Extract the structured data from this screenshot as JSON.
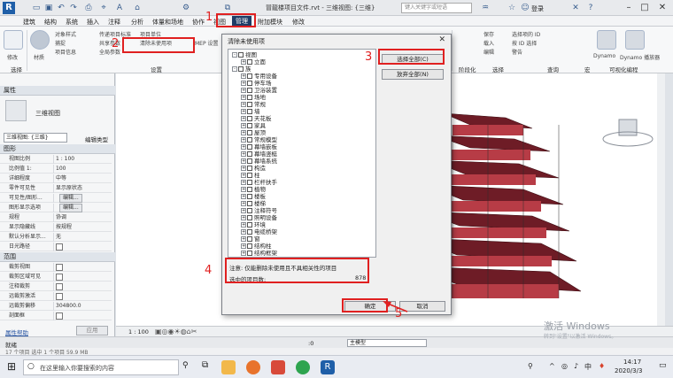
{
  "app": {
    "title": "冒龍楼项目文件.rvt - 三维视图: {三维}",
    "search_placeholder": "键入关键字或短语",
    "login": "登录",
    "logo_letter": "R"
  },
  "menu": [
    {
      "label": "建筑"
    },
    {
      "label": "结构"
    },
    {
      "label": "系统"
    },
    {
      "label": "插入"
    },
    {
      "label": "注释"
    },
    {
      "label": "分析"
    },
    {
      "label": "体量和场地"
    },
    {
      "label": "协作"
    },
    {
      "label": "视图"
    },
    {
      "label": "管理"
    },
    {
      "label": "附加模块"
    },
    {
      "label": "修改"
    }
  ],
  "ribbon": {
    "modify_label": "修改",
    "material_label": "材质",
    "items": [
      "对象样式",
      "捕捉",
      "项目信息",
      "共享参数",
      "传递项目标准",
      "清除未使用项",
      "MEP 设置",
      "项目单位",
      "全局参数"
    ],
    "right_items": [
      "选择项的 ID",
      "按 ID 选择",
      "警告",
      "保存",
      "载入",
      "编辑",
      "Dynamo",
      "Dynamo 播放器"
    ],
    "groups": [
      "选择",
      "设置",
      "阶段化",
      "选择",
      "查询",
      "宏",
      "可视化编程"
    ]
  },
  "properties": {
    "header": "属性",
    "type_name": "三维视图",
    "selector": "三维视图: {三维}",
    "edit_type": "编辑类型",
    "section_graphics": "图形",
    "rows": [
      {
        "k": "视图比例",
        "v": "1 : 100"
      },
      {
        "k": "比例值 1:",
        "v": "100"
      },
      {
        "k": "详细程度",
        "v": "中等"
      },
      {
        "k": "零件可见性",
        "v": "显示原状态"
      },
      {
        "k": "可见性/图形...",
        "v": "编辑..."
      },
      {
        "k": "图形显示选项",
        "v": "编辑..."
      },
      {
        "k": "规程",
        "v": "协调"
      },
      {
        "k": "显示隐藏线",
        "v": "按规程"
      },
      {
        "k": "默认分析显示...",
        "v": "无"
      },
      {
        "k": "日光路径",
        "v": ""
      }
    ],
    "section_extents": "范围",
    "rows2": [
      {
        "k": "裁剪视图",
        "v": ""
      },
      {
        "k": "裁剪区域可见",
        "v": ""
      },
      {
        "k": "注释裁剪",
        "v": ""
      },
      {
        "k": "远裁剪激活",
        "v": ""
      },
      {
        "k": "远裁剪偏移",
        "v": "304800.0"
      },
      {
        "k": "剖面框",
        "v": ""
      }
    ],
    "help": "属性帮助",
    "apply": "应用"
  },
  "view_scale": "1 : 100",
  "statusbar": {
    "left": "就绪",
    "zero": ":0",
    "model": "主模型",
    "info": "17 个项目   选中 1 个项目 59.9 MB"
  },
  "dialog": {
    "title": "清除未使用项",
    "tree": [
      {
        "label": "视图",
        "indent": 0,
        "exp": "-"
      },
      {
        "label": "立面",
        "indent": 1,
        "exp": "+"
      },
      {
        "label": "族",
        "indent": 0,
        "exp": "-"
      },
      {
        "label": "专用设备",
        "indent": 1,
        "exp": "+"
      },
      {
        "label": "停车场",
        "indent": 1,
        "exp": "+"
      },
      {
        "label": "卫浴装置",
        "indent": 1,
        "exp": "+"
      },
      {
        "label": "场地",
        "indent": 1,
        "exp": "+"
      },
      {
        "label": "常规",
        "indent": 1,
        "exp": "+"
      },
      {
        "label": "墙",
        "indent": 1,
        "exp": "+"
      },
      {
        "label": "天花板",
        "indent": 1,
        "exp": "+"
      },
      {
        "label": "家具",
        "indent": 1,
        "exp": "+"
      },
      {
        "label": "屋顶",
        "indent": 1,
        "exp": "+"
      },
      {
        "label": "常规模型",
        "indent": 1,
        "exp": "+"
      },
      {
        "label": "幕墙嵌板",
        "indent": 1,
        "exp": "+"
      },
      {
        "label": "幕墙竖梃",
        "indent": 1,
        "exp": "+"
      },
      {
        "label": "幕墙系统",
        "indent": 1,
        "exp": "+"
      },
      {
        "label": "构造",
        "indent": 1,
        "exp": "+"
      },
      {
        "label": "柱",
        "indent": 1,
        "exp": "+"
      },
      {
        "label": "栏杆扶手",
        "indent": 1,
        "exp": "+"
      },
      {
        "label": "植物",
        "indent": 1,
        "exp": "+"
      },
      {
        "label": "楼板",
        "indent": 1,
        "exp": "+"
      },
      {
        "label": "楼梯",
        "indent": 1,
        "exp": "+"
      },
      {
        "label": "注释符号",
        "indent": 1,
        "exp": "+"
      },
      {
        "label": "照明设备",
        "indent": 1,
        "exp": "+"
      },
      {
        "label": "环境",
        "indent": 1,
        "exp": "+"
      },
      {
        "label": "电缆桥架",
        "indent": 1,
        "exp": "+"
      },
      {
        "label": "窗",
        "indent": 1,
        "exp": "+"
      },
      {
        "label": "结构柱",
        "indent": 1,
        "exp": "+"
      },
      {
        "label": "结构框架",
        "indent": 1,
        "exp": "+"
      }
    ],
    "btn_select_all": "选择全部(C)",
    "btn_deselect_all": "放弃全部(N)",
    "note": "注意:  仅能删除未使用且不具相关性的项目",
    "selected_label": "选中的项目数:",
    "selected_count": "878",
    "ok": "确定",
    "cancel": "取消"
  },
  "annotations": [
    "1",
    "2",
    "3",
    "4",
    "5"
  ],
  "watermark": {
    "line1": "激活 Windows",
    "line2": "转到\"设置\"以激活 Windows。"
  },
  "taskbar": {
    "search_placeholder": "在这里输入你要搜索的内容",
    "time": "14:17",
    "date": "2020/3/3",
    "lang": "中"
  },
  "colors": {
    "accent": "#1e3c66",
    "annotation": "#e02020",
    "building": "#8a2530"
  }
}
